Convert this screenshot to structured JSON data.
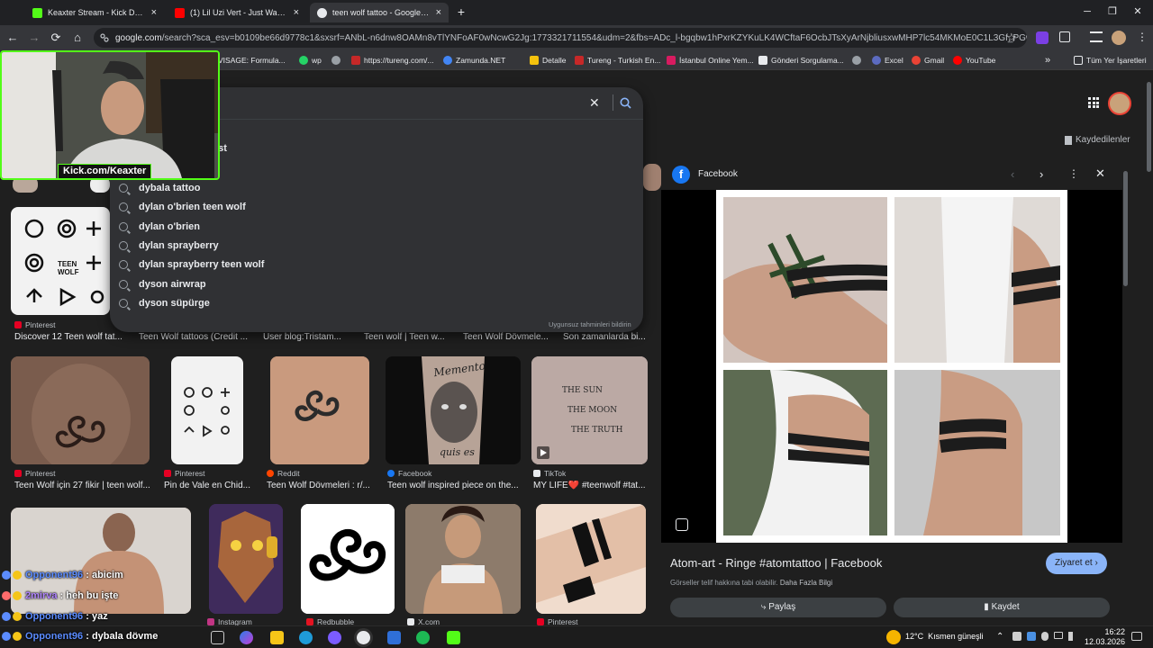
{
  "browser": {
    "tabs": [
      {
        "title": "Keaxter Stream - Kick Dashboa",
        "close": "×",
        "favicon_color": "#53fc18"
      },
      {
        "title": "(1) Lil Uzi Vert - Just Wanna Ro",
        "close": "×",
        "favicon_color": "#ff0000"
      },
      {
        "title": "teen wolf tattoo - Google'da Ar",
        "close": "×",
        "favicon_color": "#e8eaed"
      }
    ],
    "new_tab_label": "+",
    "window_controls": {
      "minimize": "─",
      "restore": "❐",
      "close": "✕"
    },
    "nav": {
      "back": "←",
      "forward": "→",
      "reload": "⟳",
      "home": "⌂"
    },
    "url_host": "google.com",
    "url_path": "/search?sca_esv=b0109be66d9778c1&sxsrf=ANbL-n6dnw8OAMn8vTlYNFoAF0wNcwG2Jg:1773321711554&udm=2&fbs=ADc_l-bgqbw1hPxrKZYKuLK4WCftaF6OcbJTsXyArNjbliusxwMHP7lc54MKMoE0C1L3Gf_PGwVuKKOZPSt...",
    "star": "☆"
  },
  "bookmarks": [
    {
      "label": "VISAGE: Formula...",
      "color": "#8a8a8a"
    },
    {
      "label": "wp",
      "color": "#25d366"
    },
    {
      "label": "",
      "color": "#9aa0a6"
    },
    {
      "label": "https://tureng.com/...",
      "color": "#c62828"
    },
    {
      "label": "Zamunda.NET",
      "color": "#4285f4"
    },
    {
      "label": "Detalle",
      "color": "#f4c20d"
    },
    {
      "label": "Tureng - Turkish En...",
      "color": "#c62828"
    },
    {
      "label": "İstanbul Online Yem...",
      "color": "#d81b60"
    },
    {
      "label": "Gönderi Sorgulama...",
      "color": "#e8eaed"
    },
    {
      "label": "",
      "color": "#9aa0a6"
    },
    {
      "label": "Excel",
      "color": "#5c6bc0"
    },
    {
      "label": "Gmail",
      "color": "#ea4335"
    },
    {
      "label": "YouTube",
      "color": "#ff0000"
    }
  ],
  "bookmarks_more": "»",
  "all_bookmarks": "Tüm Yer İşaretleri",
  "search": {
    "clear": "✕",
    "partial_top": "est",
    "suggestions": [
      "dybala tattoo",
      "dylan o'brien teen wolf",
      "dylan o'brien",
      "dylan sprayberry",
      "dylan sprayberry teen wolf",
      "dyson airwrap",
      "dyson süpürge"
    ],
    "report": "Uygunsuz tahminleri bildirin"
  },
  "header": {
    "saved": "Kaydedilenler"
  },
  "results": {
    "row1": [
      {
        "source": "Pinterest",
        "caption": "Discover 12 Teen wolf tat...",
        "color": "#e60023"
      },
      {
        "source": "",
        "caption": "Teen Wolf tattoos (Credit ...",
        "color": ""
      },
      {
        "source": "",
        "caption": "User blog:Tristam...",
        "color": ""
      },
      {
        "source": "",
        "caption": "Teen wolf | Teen w...",
        "color": ""
      },
      {
        "source": "",
        "caption": "Teen Wolf Dövmele...",
        "color": ""
      },
      {
        "source": "",
        "caption": "Son zamanlarda bi...",
        "color": ""
      }
    ],
    "row2": [
      {
        "source": "Pinterest",
        "caption": "Teen Wolf için 27 fikir | teen wolf...",
        "color": "#e60023"
      },
      {
        "source": "Pinterest",
        "caption": "Pin de Vale en Chid...",
        "color": "#e60023"
      },
      {
        "source": "Reddit",
        "caption": "Teen Wolf Dövmeleri : r/...",
        "color": "#ff4500"
      },
      {
        "source": "Facebook",
        "caption": "Teen wolf inspired piece on the...",
        "color": "#1877f2"
      },
      {
        "source": "TikTok",
        "caption": "MY LIFE❤️ #teenwolf #tat...",
        "color": "#e8eaed"
      }
    ],
    "row3_sources": [
      {
        "source": "Instagram",
        "color": "#c13584"
      },
      {
        "source": "Redbubble",
        "color": "#e41321"
      },
      {
        "source": "X.com",
        "color": "#e8eaed"
      },
      {
        "source": "Pinterest",
        "color": "#e60023"
      }
    ],
    "tattoo_text": {
      "line1": "THE SUN",
      "line2": "THE MOON",
      "line3": "THE TRUTH",
      "memento_top": "Memento",
      "memento_bottom": "quis es"
    }
  },
  "side_panel": {
    "source": "Facebook",
    "title": "Atom-art - Ringe #atomtattoo | Facebook",
    "visit": "Ziyaret et",
    "copyright": "Görseller telif hakkına tabi olabilir.",
    "more_info": "Daha Fazla Bilgi",
    "share": "Paylaş",
    "save": "Kaydet"
  },
  "stream": {
    "channel": "Kick.com/Keaxter",
    "chat": [
      {
        "user": "Opponent96",
        "msg": "abicim",
        "color": "#5b8cff"
      },
      {
        "user": "2mirva",
        "msg": "heh bu işte",
        "color": "#b084ff"
      },
      {
        "user": "Opponent96",
        "msg": "yaz",
        "color": "#5b8cff"
      },
      {
        "user": "Opponent96",
        "msg": "dybala dövme",
        "color": "#5b8cff"
      }
    ]
  },
  "taskbar": {
    "weather_temp": "12°C",
    "weather_desc": "Kısmen güneşli",
    "time": "16:22",
    "date": "12.03.2026"
  }
}
